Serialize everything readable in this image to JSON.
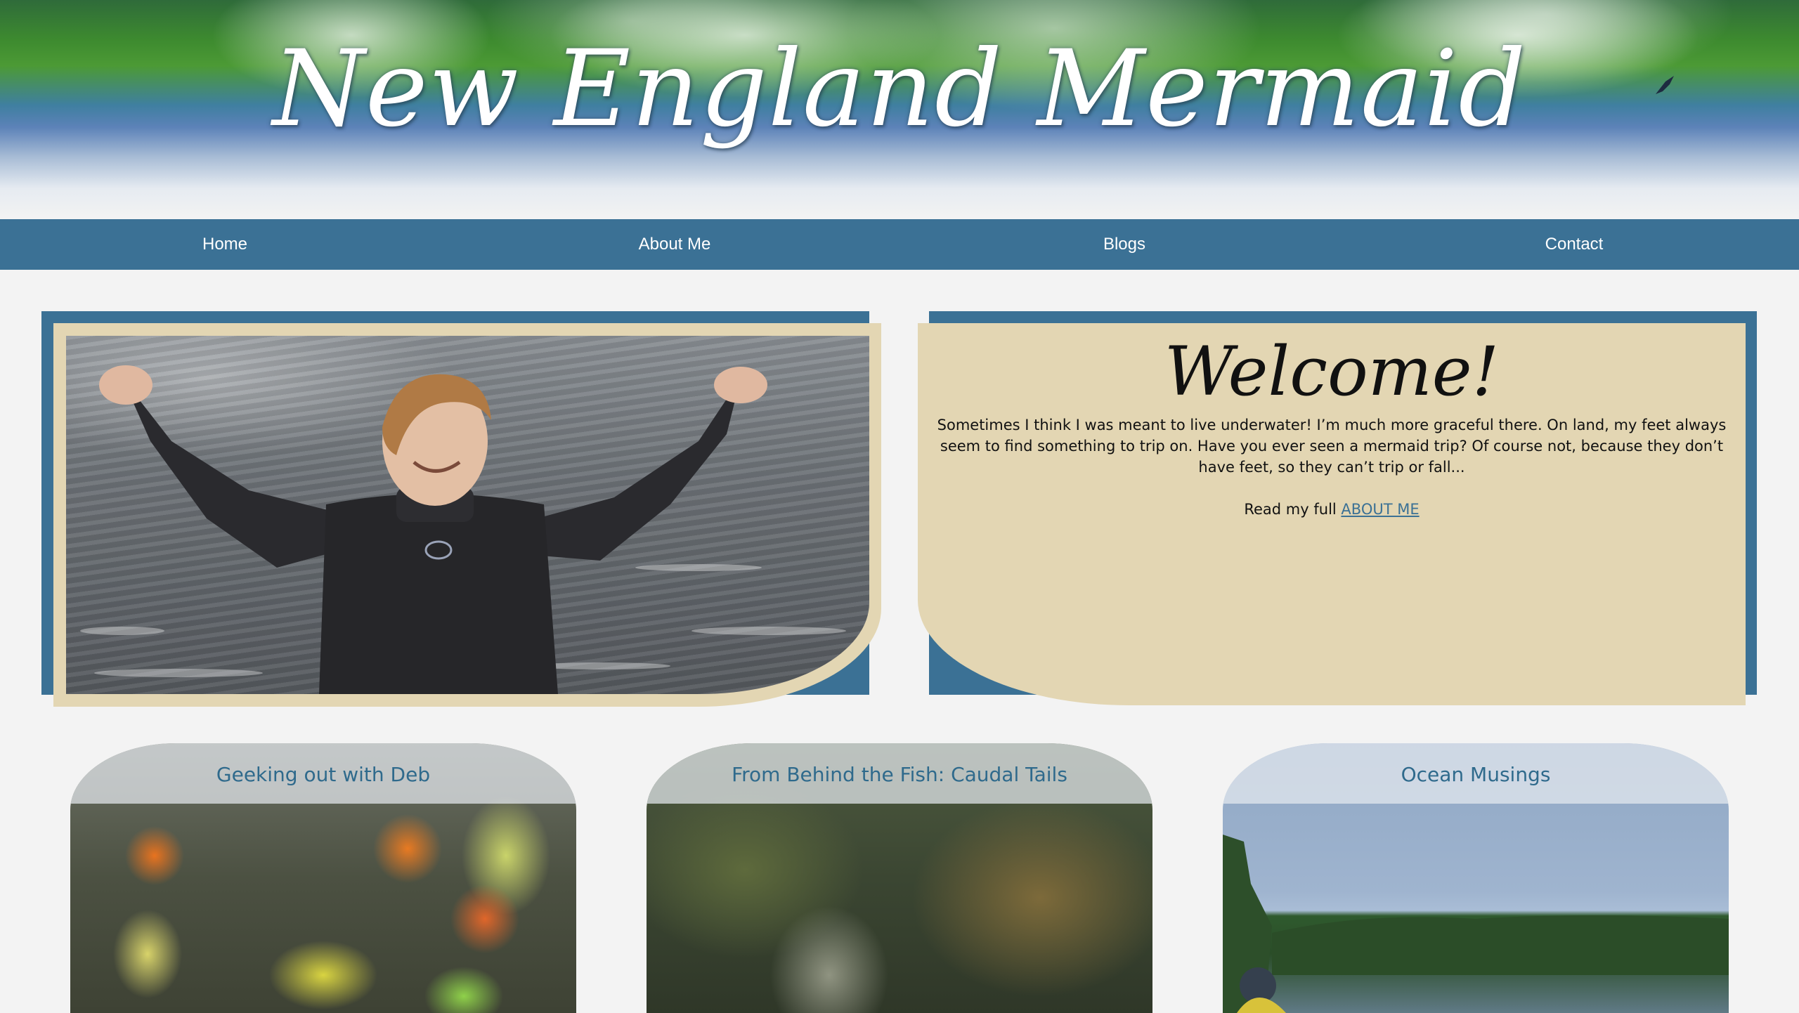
{
  "header": {
    "title": "New England Mermaid"
  },
  "nav": {
    "items": [
      "Home",
      "About Me",
      "Blogs",
      "Contact"
    ]
  },
  "welcome": {
    "heading": "Welcome!",
    "body": "Sometimes I think I was meant to live underwater! I’m much more graceful there. On land, my feet always seem to find something to trip on. Have you ever seen a mermaid trip? Of course not, because they don’t have feet, so they can’t trip or fall...",
    "read_prefix": "Read my full ",
    "read_link": "ABOUT ME"
  },
  "blogs": [
    {
      "title": "Geeking out with Deb"
    },
    {
      "title": "From Behind the Fish: Caudal Tails"
    },
    {
      "title": "Ocean Musings"
    }
  ],
  "colors": {
    "nav_bg": "#3b7195",
    "card_tan": "#e3d6b3",
    "page_bg": "#f3f3f3",
    "link": "#3b7195",
    "blog_title": "#2f6a8c"
  }
}
